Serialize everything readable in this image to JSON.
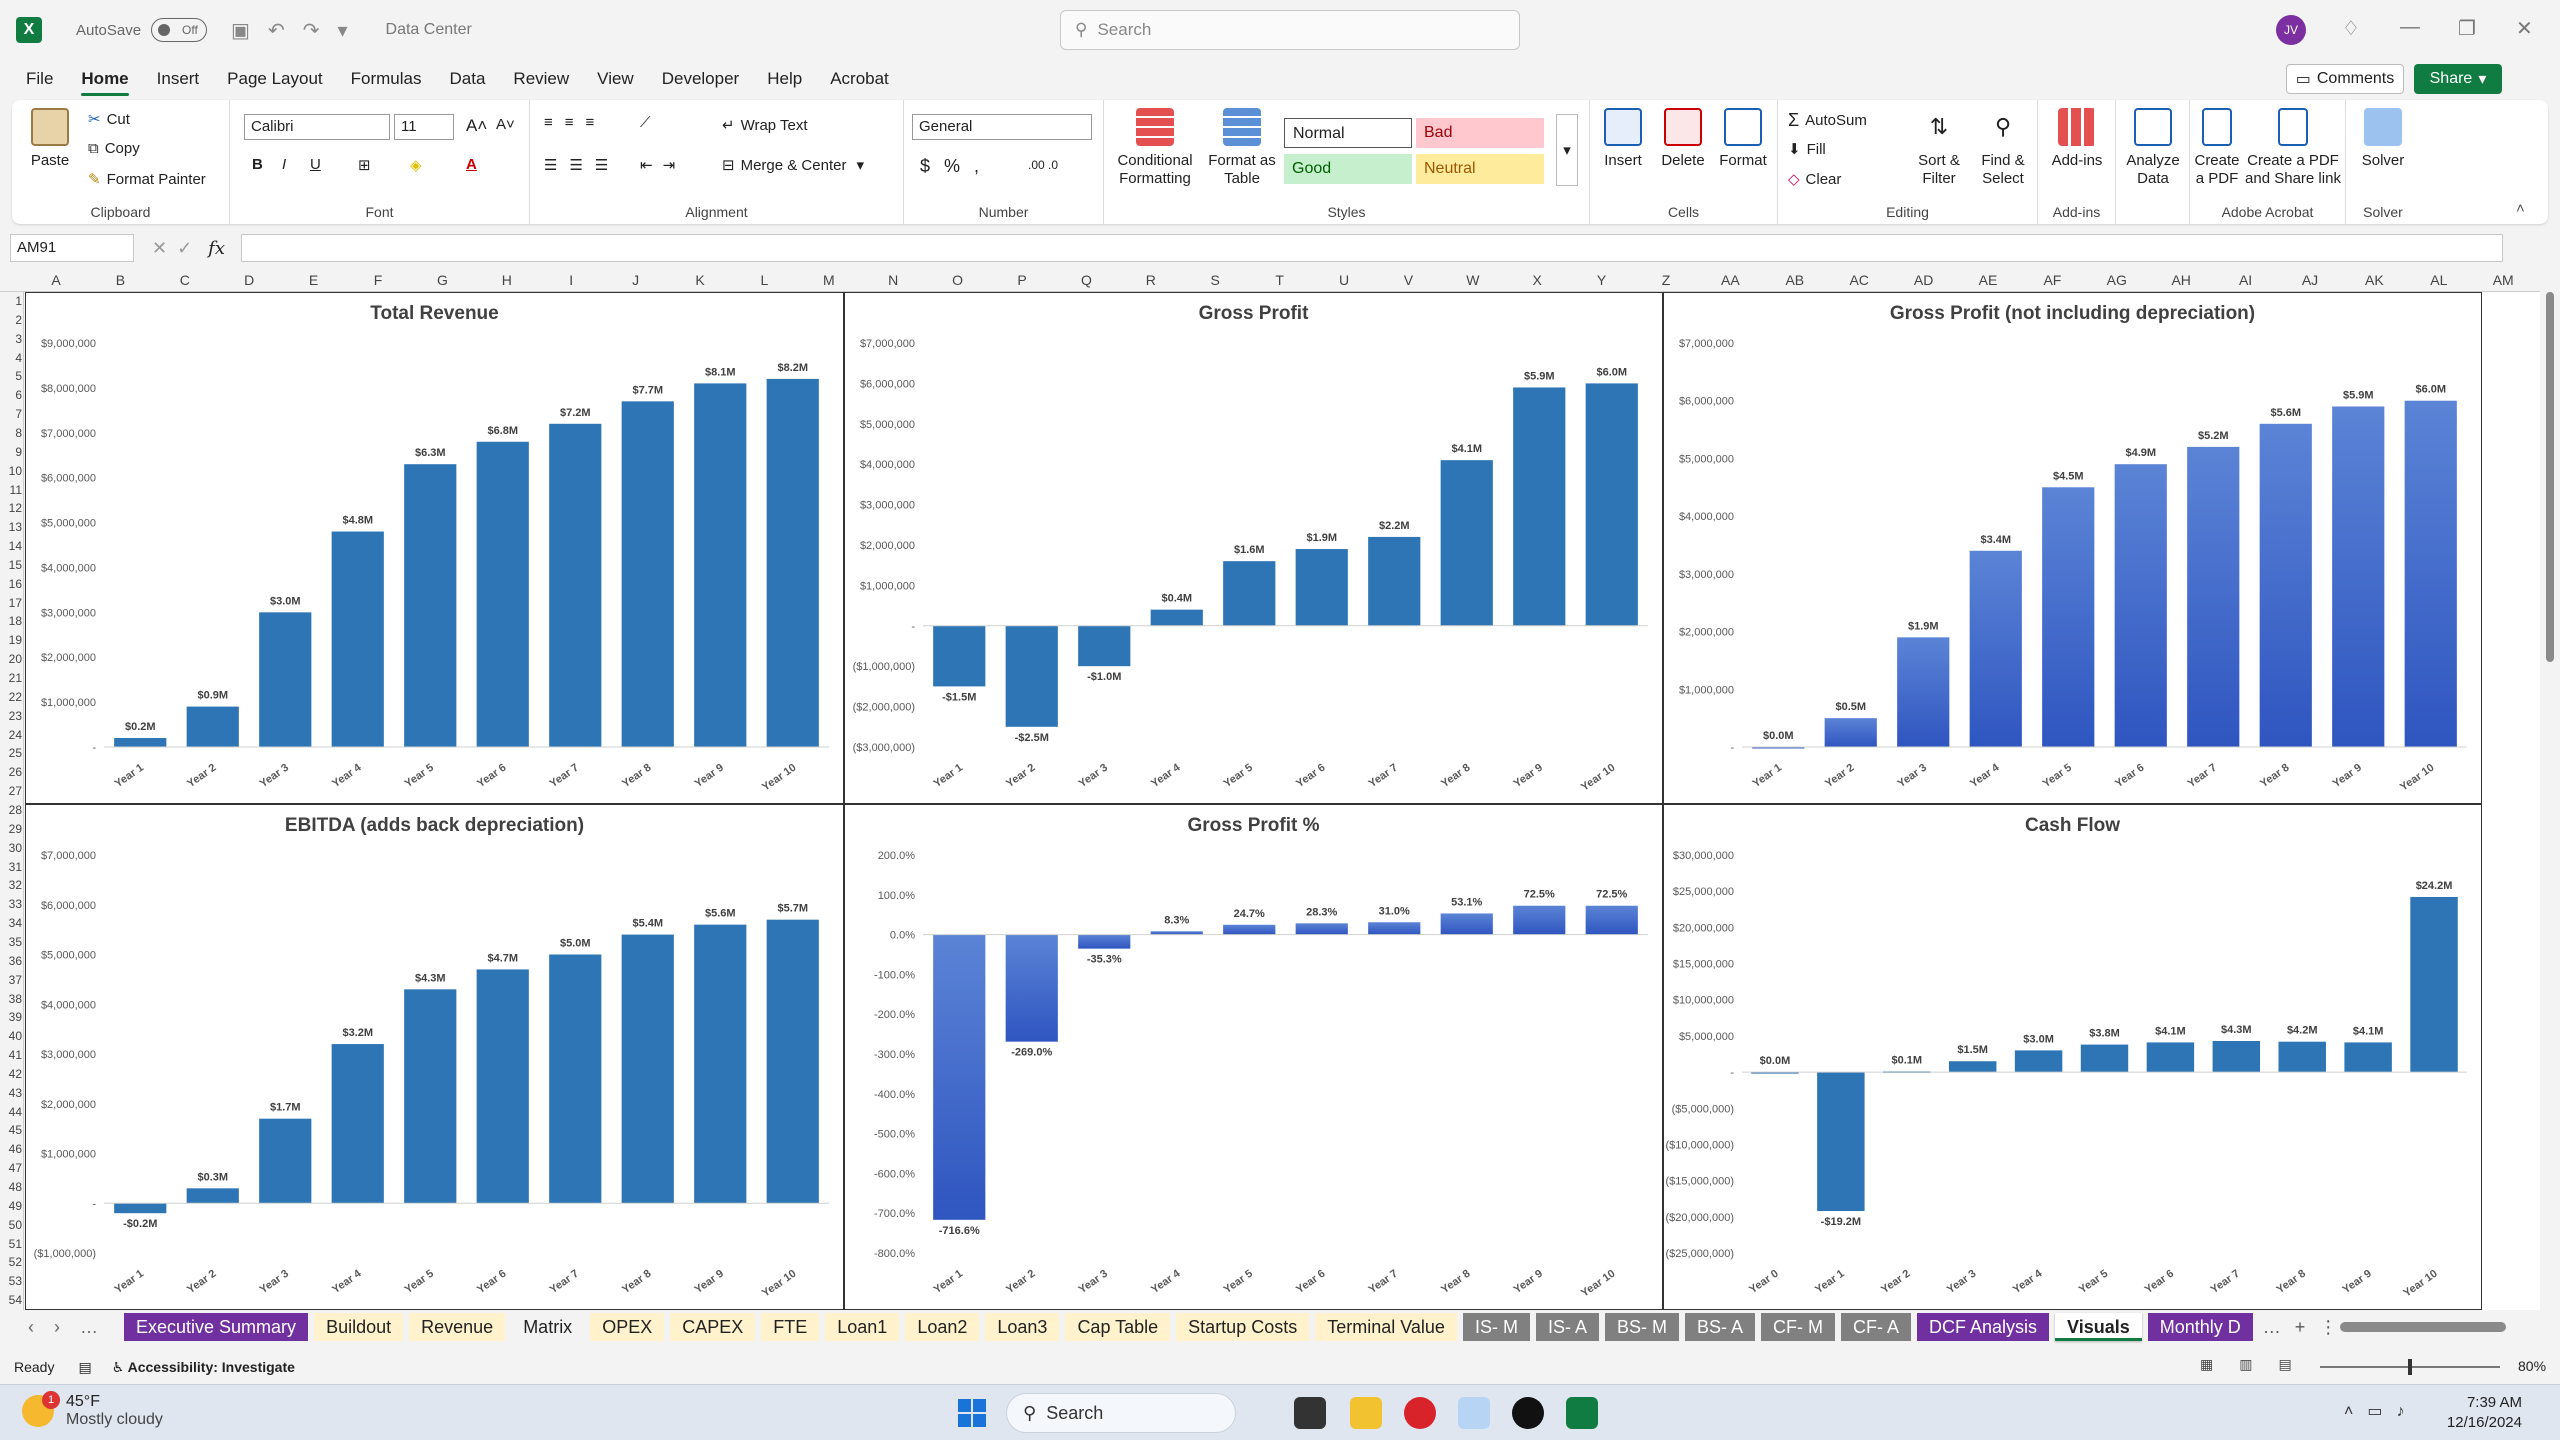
{
  "titlebar": {
    "autosave": "AutoSave",
    "autosave_state": "Off",
    "document": "Data Center",
    "search_placeholder": "Search",
    "user_initials": "JV"
  },
  "menu": {
    "tabs": [
      "File",
      "Home",
      "Insert",
      "Page Layout",
      "Formulas",
      "Data",
      "Review",
      "View",
      "Developer",
      "Help",
      "Acrobat"
    ],
    "active": "Home",
    "comments": "Comments",
    "share": "Share"
  },
  "ribbon": {
    "clipboard": {
      "paste": "Paste",
      "cut": "Cut",
      "copy": "Copy",
      "format_painter": "Format Painter",
      "label": "Clipboard"
    },
    "font": {
      "name": "Calibri",
      "size": "11",
      "label": "Font"
    },
    "alignment": {
      "wrap": "Wrap Text",
      "merge": "Merge & Center",
      "label": "Alignment"
    },
    "number": {
      "format": "General",
      "label": "Number"
    },
    "styles": {
      "conditional": "Conditional Formatting",
      "format_table": "Format as Table",
      "normal": "Normal",
      "bad": "Bad",
      "good": "Good",
      "neutral": "Neutral",
      "label": "Styles"
    },
    "cells": {
      "insert": "Insert",
      "delete": "Delete",
      "format": "Format",
      "label": "Cells"
    },
    "editing": {
      "autosum": "AutoSum",
      "fill": "Fill",
      "clear": "Clear",
      "sort": "Sort & Filter",
      "find": "Find & Select",
      "label": "Editing"
    },
    "addins": {
      "addins": "Add-ins",
      "label": "Add-ins"
    },
    "analyze": {
      "analyze": "Analyze Data"
    },
    "acrobat": {
      "create_pdf": "Create a PDF",
      "create_share": "Create a PDF and Share link",
      "label": "Adobe Acrobat"
    },
    "solver": {
      "solver": "Solver",
      "label": "Solver"
    },
    "colors": {
      "bad_bg": "#ffc7ce",
      "bad_fg": "#9c0006",
      "good_bg": "#c6efce",
      "good_fg": "#006100",
      "neutral_bg": "#ffeb9c",
      "neutral_fg": "#9c5700"
    }
  },
  "formula_bar": {
    "name_box": "AM91",
    "fx": "fx",
    "value": ""
  },
  "grid": {
    "columns": [
      "A",
      "B",
      "C",
      "D",
      "E",
      "F",
      "G",
      "H",
      "I",
      "J",
      "K",
      "L",
      "M",
      "N",
      "O",
      "P",
      "Q",
      "R",
      "S",
      "T",
      "U",
      "V",
      "W",
      "X",
      "Y",
      "Z",
      "AA",
      "AB",
      "AC",
      "AD",
      "AE",
      "AF",
      "AG",
      "AH",
      "AI",
      "AJ",
      "AK",
      "AL",
      "AM"
    ],
    "first_row": 1,
    "last_row": 54
  },
  "chart_data": [
    {
      "type": "bar",
      "title": "Total Revenue",
      "categories": [
        "Year 1",
        "Year 2",
        "Year 3",
        "Year 4",
        "Year 5",
        "Year 6",
        "Year 7",
        "Year 8",
        "Year 9",
        "Year 10"
      ],
      "values": [
        0.2,
        0.9,
        3.0,
        4.8,
        6.3,
        6.8,
        7.2,
        7.7,
        8.1,
        8.2
      ],
      "labels": [
        "$0.2M",
        "$0.9M",
        "$3.0M",
        "$4.8M",
        "$6.3M",
        "$6.8M",
        "$7.2M",
        "$7.7M",
        "$8.1M",
        "$8.2M"
      ],
      "ylim": [
        0,
        9
      ],
      "yticks": [
        0,
        1,
        2,
        3,
        4,
        5,
        6,
        7,
        8,
        9
      ],
      "ytick_labels": [
        "-",
        "$1,000,000",
        "$2,000,000",
        "$3,000,000",
        "$4,000,000",
        "$5,000,000",
        "$6,000,000",
        "$7,000,000",
        "$8,000,000",
        "$9,000,000"
      ],
      "color": "#2e75b6",
      "gradient": false
    },
    {
      "type": "bar",
      "title": "Gross Profit",
      "categories": [
        "Year 1",
        "Year 2",
        "Year 3",
        "Year 4",
        "Year 5",
        "Year 6",
        "Year 7",
        "Year 8",
        "Year 9",
        "Year 10"
      ],
      "values": [
        -1.5,
        -2.5,
        -1.0,
        0.4,
        1.6,
        1.9,
        2.2,
        4.1,
        5.9,
        6.0
      ],
      "labels": [
        "-$1.5M",
        "-$2.5M",
        "-$1.0M",
        "$0.4M",
        "$1.6M",
        "$1.9M",
        "$2.2M",
        "$4.1M",
        "$5.9M",
        "$6.0M"
      ],
      "ylim": [
        -3,
        7
      ],
      "yticks": [
        -3,
        -2,
        -1,
        0,
        1,
        2,
        3,
        4,
        5,
        6,
        7
      ],
      "ytick_labels": [
        "($3,000,000)",
        "($2,000,000)",
        "($1,000,000)",
        "-",
        "$1,000,000",
        "$2,000,000",
        "$3,000,000",
        "$4,000,000",
        "$5,000,000",
        "$6,000,000",
        "$7,000,000"
      ],
      "color": "#2e75b6",
      "gradient": false
    },
    {
      "type": "bar",
      "title": "Gross Profit (not including depreciation)",
      "categories": [
        "Year 1",
        "Year 2",
        "Year 3",
        "Year 4",
        "Year 5",
        "Year 6",
        "Year 7",
        "Year 8",
        "Year 9",
        "Year 10"
      ],
      "values": [
        0.0,
        0.5,
        1.9,
        3.4,
        4.5,
        4.9,
        5.2,
        5.6,
        5.9,
        6.0
      ],
      "labels": [
        "$0.0M",
        "$0.5M",
        "$1.9M",
        "$3.4M",
        "$4.5M",
        "$4.9M",
        "$5.2M",
        "$5.6M",
        "$5.9M",
        "$6.0M"
      ],
      "ylim": [
        0,
        7
      ],
      "yticks": [
        0,
        1,
        2,
        3,
        4,
        5,
        6,
        7
      ],
      "ytick_labels": [
        "-",
        "$1,000,000",
        "$2,000,000",
        "$3,000,000",
        "$4,000,000",
        "$5,000,000",
        "$6,000,000",
        "$7,000,000"
      ],
      "color": "#3d66c8",
      "gradient": true
    },
    {
      "type": "bar",
      "title": "EBITDA (adds back depreciation)",
      "categories": [
        "Year 1",
        "Year 2",
        "Year 3",
        "Year 4",
        "Year 5",
        "Year 6",
        "Year 7",
        "Year 8",
        "Year 9",
        "Year 10"
      ],
      "values": [
        -0.2,
        0.3,
        1.7,
        3.2,
        4.3,
        4.7,
        5.0,
        5.4,
        5.6,
        5.7
      ],
      "labels": [
        "-$0.2M",
        "$0.3M",
        "$1.7M",
        "$3.2M",
        "$4.3M",
        "$4.7M",
        "$5.0M",
        "$5.4M",
        "$5.6M",
        "$5.7M"
      ],
      "ylim": [
        -1,
        7
      ],
      "yticks": [
        -1,
        0,
        1,
        2,
        3,
        4,
        5,
        6,
        7
      ],
      "ytick_labels": [
        "($1,000,000)",
        "-",
        "$1,000,000",
        "$2,000,000",
        "$3,000,000",
        "$4,000,000",
        "$5,000,000",
        "$6,000,000",
        "$7,000,000"
      ],
      "color": "#2e75b6",
      "gradient": false
    },
    {
      "type": "bar",
      "title": "Gross Profit %",
      "categories": [
        "Year 1",
        "Year 2",
        "Year 3",
        "Year 4",
        "Year 5",
        "Year 6",
        "Year 7",
        "Year 8",
        "Year 9",
        "Year 10"
      ],
      "values": [
        -716.6,
        -269.0,
        -35.3,
        8.3,
        24.7,
        28.3,
        31.0,
        53.1,
        72.5,
        72.5
      ],
      "labels": [
        "-716.6%",
        "-269.0%",
        "-35.3%",
        "8.3%",
        "24.7%",
        "28.3%",
        "31.0%",
        "53.1%",
        "72.5%",
        "72.5%"
      ],
      "ylim": [
        -800,
        200
      ],
      "yticks": [
        -800,
        -700,
        -600,
        -500,
        -400,
        -300,
        -200,
        -100,
        0,
        100,
        200
      ],
      "ytick_labels": [
        "-800.0%",
        "-700.0%",
        "-600.0%",
        "-500.0%",
        "-400.0%",
        "-300.0%",
        "-200.0%",
        "-100.0%",
        "0.0%",
        "100.0%",
        "200.0%"
      ],
      "color": "#3d66c8",
      "gradient": true
    },
    {
      "type": "bar",
      "title": "Cash Flow",
      "categories": [
        "Year 0",
        "Year 1",
        "Year 2",
        "Year 3",
        "Year 4",
        "Year 5",
        "Year 6",
        "Year 7",
        "Year 8",
        "Year 9",
        "Year 10"
      ],
      "values": [
        0.0,
        -19.2,
        0.1,
        1.5,
        3.0,
        3.8,
        4.1,
        4.3,
        4.2,
        4.1,
        24.2
      ],
      "labels": [
        "$0.0M",
        "-$19.2M",
        "$0.1M",
        "$1.5M",
        "$3.0M",
        "$3.8M",
        "$4.1M",
        "$4.3M",
        "$4.2M",
        "$4.1M",
        "$24.2M"
      ],
      "ylim": [
        -25,
        30
      ],
      "yticks": [
        -25,
        -20,
        -15,
        -10,
        -5,
        0,
        5,
        10,
        15,
        20,
        25,
        30
      ],
      "ytick_labels": [
        "($25,000,000)",
        "($20,000,000)",
        "($15,000,000)",
        "($10,000,000)",
        "($5,000,000)",
        "-",
        "$5,000,000",
        "$10,000,000",
        "$15,000,000",
        "$20,000,000",
        "$25,000,000",
        "$30,000,000"
      ],
      "color": "#2e75b6",
      "gradient": false
    }
  ],
  "sheet_tabs": [
    {
      "name": "Executive Summary",
      "bg": "#7030a0",
      "fg": "#ffffff"
    },
    {
      "name": "Buildout",
      "bg": "#fff2cc",
      "fg": "#222222"
    },
    {
      "name": "Revenue",
      "bg": "#fff2cc",
      "fg": "#222222"
    },
    {
      "name": "Matrix",
      "bg": "#f3f3f3",
      "fg": "#222222"
    },
    {
      "name": "OPEX",
      "bg": "#fff2cc",
      "fg": "#222222"
    },
    {
      "name": "CAPEX",
      "bg": "#fff2cc",
      "fg": "#222222"
    },
    {
      "name": "FTE",
      "bg": "#fff2cc",
      "fg": "#222222"
    },
    {
      "name": "Loan1",
      "bg": "#fff2cc",
      "fg": "#222222"
    },
    {
      "name": "Loan2",
      "bg": "#fff2cc",
      "fg": "#222222"
    },
    {
      "name": "Loan3",
      "bg": "#fff2cc",
      "fg": "#222222"
    },
    {
      "name": "Cap Table",
      "bg": "#fff2cc",
      "fg": "#222222"
    },
    {
      "name": "Startup Costs",
      "bg": "#fff2cc",
      "fg": "#222222"
    },
    {
      "name": "Terminal Value",
      "bg": "#fff2cc",
      "fg": "#222222"
    },
    {
      "name": "IS- M",
      "bg": "#808080",
      "fg": "#ffffff"
    },
    {
      "name": "IS- A",
      "bg": "#808080",
      "fg": "#ffffff"
    },
    {
      "name": "BS- M",
      "bg": "#808080",
      "fg": "#ffffff"
    },
    {
      "name": "BS- A",
      "bg": "#808080",
      "fg": "#ffffff"
    },
    {
      "name": "CF- M",
      "bg": "#808080",
      "fg": "#ffffff"
    },
    {
      "name": "CF- A",
      "bg": "#808080",
      "fg": "#ffffff"
    },
    {
      "name": "DCF Analysis",
      "bg": "#7030a0",
      "fg": "#ffffff"
    },
    {
      "name": "Visuals",
      "bg": "#ffffff",
      "fg": "#222222",
      "active": true
    },
    {
      "name": "Monthly D",
      "bg": "#7030a0",
      "fg": "#ffffff"
    }
  ],
  "status": {
    "ready": "Ready",
    "accessibility": "Accessibility: Investigate",
    "zoom": "80%"
  },
  "taskbar": {
    "temp": "45°F",
    "weather": "Mostly cloudy",
    "search": "Search",
    "time": "7:39 AM",
    "date": "12/16/2024",
    "badge": "1"
  }
}
